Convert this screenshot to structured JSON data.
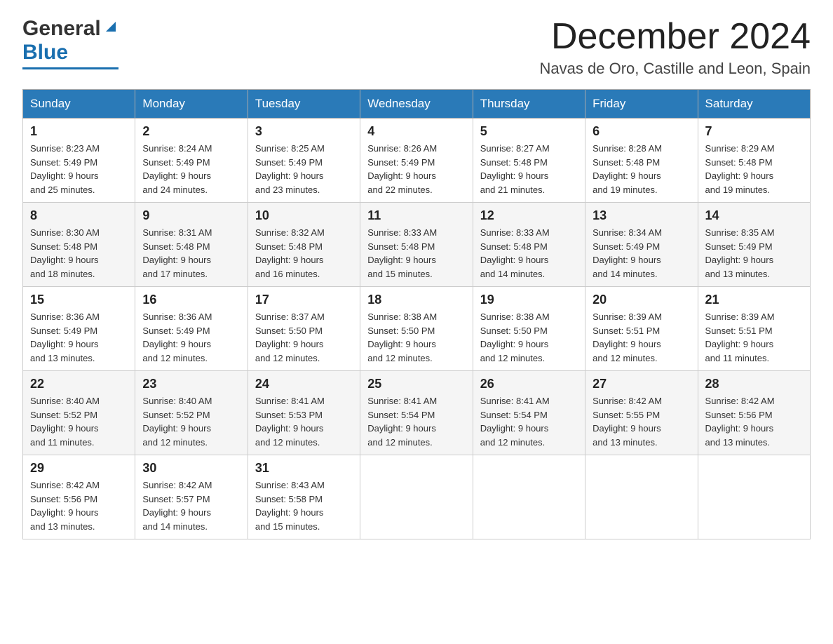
{
  "header": {
    "logo_general": "General",
    "logo_blue": "Blue",
    "month_title": "December 2024",
    "location": "Navas de Oro, Castille and Leon, Spain"
  },
  "weekdays": [
    "Sunday",
    "Monday",
    "Tuesday",
    "Wednesday",
    "Thursday",
    "Friday",
    "Saturday"
  ],
  "weeks": [
    [
      {
        "day": "1",
        "sunrise": "8:23 AM",
        "sunset": "5:49 PM",
        "daylight": "9 hours and 25 minutes."
      },
      {
        "day": "2",
        "sunrise": "8:24 AM",
        "sunset": "5:49 PM",
        "daylight": "9 hours and 24 minutes."
      },
      {
        "day": "3",
        "sunrise": "8:25 AM",
        "sunset": "5:49 PM",
        "daylight": "9 hours and 23 minutes."
      },
      {
        "day": "4",
        "sunrise": "8:26 AM",
        "sunset": "5:49 PM",
        "daylight": "9 hours and 22 minutes."
      },
      {
        "day": "5",
        "sunrise": "8:27 AM",
        "sunset": "5:48 PM",
        "daylight": "9 hours and 21 minutes."
      },
      {
        "day": "6",
        "sunrise": "8:28 AM",
        "sunset": "5:48 PM",
        "daylight": "9 hours and 19 minutes."
      },
      {
        "day": "7",
        "sunrise": "8:29 AM",
        "sunset": "5:48 PM",
        "daylight": "9 hours and 19 minutes."
      }
    ],
    [
      {
        "day": "8",
        "sunrise": "8:30 AM",
        "sunset": "5:48 PM",
        "daylight": "9 hours and 18 minutes."
      },
      {
        "day": "9",
        "sunrise": "8:31 AM",
        "sunset": "5:48 PM",
        "daylight": "9 hours and 17 minutes."
      },
      {
        "day": "10",
        "sunrise": "8:32 AM",
        "sunset": "5:48 PM",
        "daylight": "9 hours and 16 minutes."
      },
      {
        "day": "11",
        "sunrise": "8:33 AM",
        "sunset": "5:48 PM",
        "daylight": "9 hours and 15 minutes."
      },
      {
        "day": "12",
        "sunrise": "8:33 AM",
        "sunset": "5:48 PM",
        "daylight": "9 hours and 14 minutes."
      },
      {
        "day": "13",
        "sunrise": "8:34 AM",
        "sunset": "5:49 PM",
        "daylight": "9 hours and 14 minutes."
      },
      {
        "day": "14",
        "sunrise": "8:35 AM",
        "sunset": "5:49 PM",
        "daylight": "9 hours and 13 minutes."
      }
    ],
    [
      {
        "day": "15",
        "sunrise": "8:36 AM",
        "sunset": "5:49 PM",
        "daylight": "9 hours and 13 minutes."
      },
      {
        "day": "16",
        "sunrise": "8:36 AM",
        "sunset": "5:49 PM",
        "daylight": "9 hours and 12 minutes."
      },
      {
        "day": "17",
        "sunrise": "8:37 AM",
        "sunset": "5:50 PM",
        "daylight": "9 hours and 12 minutes."
      },
      {
        "day": "18",
        "sunrise": "8:38 AM",
        "sunset": "5:50 PM",
        "daylight": "9 hours and 12 minutes."
      },
      {
        "day": "19",
        "sunrise": "8:38 AM",
        "sunset": "5:50 PM",
        "daylight": "9 hours and 12 minutes."
      },
      {
        "day": "20",
        "sunrise": "8:39 AM",
        "sunset": "5:51 PM",
        "daylight": "9 hours and 12 minutes."
      },
      {
        "day": "21",
        "sunrise": "8:39 AM",
        "sunset": "5:51 PM",
        "daylight": "9 hours and 11 minutes."
      }
    ],
    [
      {
        "day": "22",
        "sunrise": "8:40 AM",
        "sunset": "5:52 PM",
        "daylight": "9 hours and 11 minutes."
      },
      {
        "day": "23",
        "sunrise": "8:40 AM",
        "sunset": "5:52 PM",
        "daylight": "9 hours and 12 minutes."
      },
      {
        "day": "24",
        "sunrise": "8:41 AM",
        "sunset": "5:53 PM",
        "daylight": "9 hours and 12 minutes."
      },
      {
        "day": "25",
        "sunrise": "8:41 AM",
        "sunset": "5:54 PM",
        "daylight": "9 hours and 12 minutes."
      },
      {
        "day": "26",
        "sunrise": "8:41 AM",
        "sunset": "5:54 PM",
        "daylight": "9 hours and 12 minutes."
      },
      {
        "day": "27",
        "sunrise": "8:42 AM",
        "sunset": "5:55 PM",
        "daylight": "9 hours and 13 minutes."
      },
      {
        "day": "28",
        "sunrise": "8:42 AM",
        "sunset": "5:56 PM",
        "daylight": "9 hours and 13 minutes."
      }
    ],
    [
      {
        "day": "29",
        "sunrise": "8:42 AM",
        "sunset": "5:56 PM",
        "daylight": "9 hours and 13 minutes."
      },
      {
        "day": "30",
        "sunrise": "8:42 AM",
        "sunset": "5:57 PM",
        "daylight": "9 hours and 14 minutes."
      },
      {
        "day": "31",
        "sunrise": "8:43 AM",
        "sunset": "5:58 PM",
        "daylight": "9 hours and 15 minutes."
      },
      null,
      null,
      null,
      null
    ]
  ],
  "labels": {
    "sunrise": "Sunrise:",
    "sunset": "Sunset:",
    "daylight": "Daylight:"
  }
}
